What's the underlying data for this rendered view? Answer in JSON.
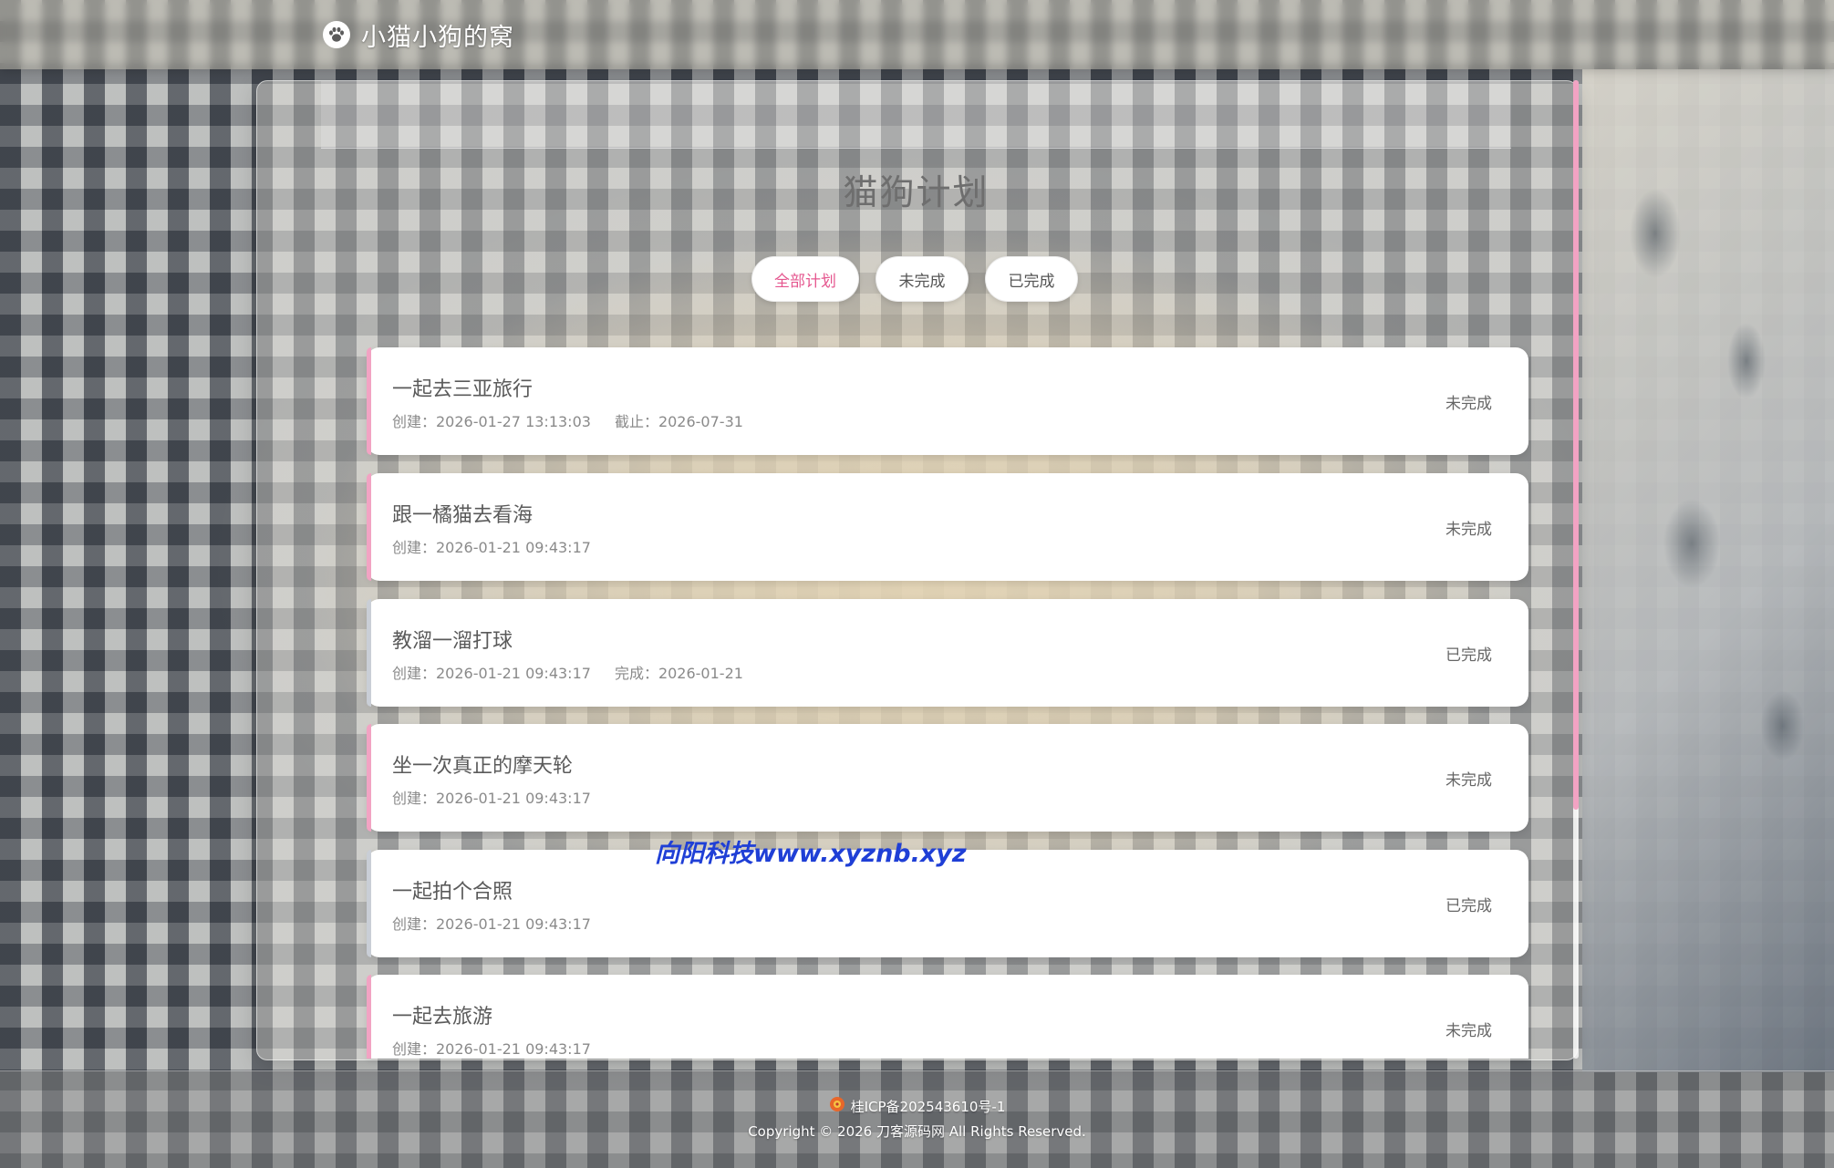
{
  "nav": {
    "brand_icon": "paw-icon",
    "brand_title": "小猫小狗的窝"
  },
  "page": {
    "title": "猫狗计划"
  },
  "filters": [
    {
      "label": "全部计划",
      "active": true
    },
    {
      "label": "未完成",
      "active": false
    },
    {
      "label": "已完成",
      "active": false
    }
  ],
  "plans": [
    {
      "title": "一起去三亚旅行",
      "created": "创建：2026-01-27 13:13:03",
      "extra": "截止：2026-07-31",
      "status": "未完成",
      "done": false
    },
    {
      "title": "跟一橘猫去看海",
      "created": "创建：2026-01-21 09:43:17",
      "extra": "",
      "status": "未完成",
      "done": false
    },
    {
      "title": "教溜一溜打球",
      "created": "创建：2026-01-21 09:43:17",
      "extra": "完成：2026-01-21",
      "status": "已完成",
      "done": true
    },
    {
      "title": "坐一次真正的摩天轮",
      "created": "创建：2026-01-21 09:43:17",
      "extra": "",
      "status": "未完成",
      "done": false
    },
    {
      "title": "一起拍个合照",
      "created": "创建：2026-01-21 09:43:17",
      "extra": "",
      "status": "已完成",
      "done": true
    },
    {
      "title": "一起去旅游",
      "created": "创建：2026-01-21 09:43:17",
      "extra": "",
      "status": "未完成",
      "done": false
    }
  ],
  "watermark": "向阳科技www.xyznb.xyz",
  "footer": {
    "icp_icon": "badge-icon",
    "icp": "桂ICP备202543610号-1",
    "copyright": "Copyright © 2026 刀客源码网 All Rights Reserved."
  },
  "colors": {
    "accent_pink": "#e5578f",
    "pending_bar": "#f2a3c3",
    "done_bar": "#c9ced6",
    "watermark_blue": "#1f3fd6"
  }
}
